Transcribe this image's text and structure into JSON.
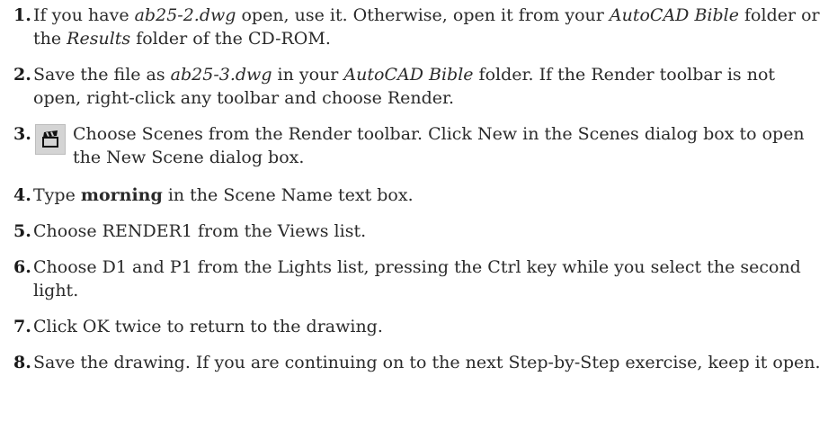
{
  "steps": [
    {
      "number": "1.",
      "parts": [
        "If you have ",
        "ab25-2.dwg",
        " open, use it. Otherwise, open it from your ",
        "AutoCAD Bible",
        " folder or the ",
        "Results",
        " folder of the CD-ROM."
      ]
    },
    {
      "number": "2.",
      "parts": [
        "Save the file as ",
        "ab25-3.dwg",
        " in your ",
        "AutoCAD Bible",
        " folder. If the Render toolbar is not open, right-click any toolbar and choose Render."
      ]
    },
    {
      "number": "3.",
      "icon": "scenes-clapperboard-icon",
      "text": "Choose Scenes from the Render toolbar. Click New in the Scenes dialog box to open the New Scene dialog box."
    },
    {
      "number": "4.",
      "parts": [
        "Type ",
        "morning",
        " in the Scene Name text box."
      ]
    },
    {
      "number": "5.",
      "text": "Choose RENDER1 from the Views list."
    },
    {
      "number": "6.",
      "text": "Choose D1 and P1 from the Lights list, pressing the Ctrl key while you select the second light."
    },
    {
      "number": "7.",
      "text": "Click OK twice to return to the drawing."
    },
    {
      "number": "8.",
      "text": "Save the drawing. If you are continuing on to the next Step-by-Step exercise, keep it open."
    }
  ]
}
